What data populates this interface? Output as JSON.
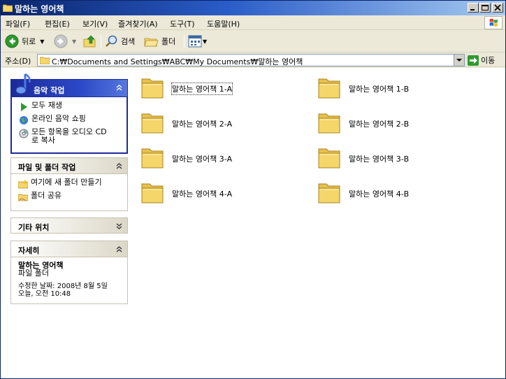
{
  "window": {
    "title": "말하는 영어책"
  },
  "menu": {
    "items": [
      "파일(F)",
      "편집(E)",
      "보기(V)",
      "즐겨찾기(A)",
      "도구(T)",
      "도움말(H)"
    ]
  },
  "toolbar": {
    "back_label": "뒤로",
    "search_label": "검색",
    "folders_label": "폴더"
  },
  "address": {
    "label": "주소(D)",
    "value": "C:₩Documents and Settings₩ABC₩My Documents₩말하는 영어책",
    "go_label": "이동"
  },
  "tasks": {
    "music": {
      "title": "음악 작업",
      "items": [
        "모두 재생",
        "온라인 음악 쇼핑",
        "모든 항목을 오디오 CD",
        "로 복사"
      ]
    },
    "file_folder": {
      "title": "파일 및 폴더 작업",
      "items": [
        "여기에 새 폴더 만들기",
        "폴더 공유"
      ]
    },
    "other": {
      "title": "기타 위치"
    },
    "details": {
      "title": "자세히",
      "name": "말하는 영어책",
      "type": "파일 폴더",
      "modified_line1": "수정한 날짜: 2008년 8월 5일",
      "modified_line2": "오늘, 오전 10:48"
    }
  },
  "folders": [
    "말하는 영어책 1-A",
    "말하는 영어책 1-B",
    "말하는 영어책 2-A",
    "말하는 영어책 2-B",
    "말하는 영어책 3-A",
    "말하는 영어책 3-B",
    "말하는 영어책 4-A",
    "말하는 영어책 4-B"
  ],
  "colors": {
    "titlebar_start": "#0a246a",
    "task_header_blue": "#1c2a9a",
    "folder_yellow": "#f5d66a"
  }
}
